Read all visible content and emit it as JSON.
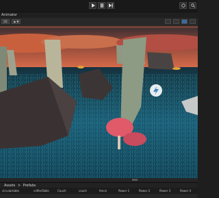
{
  "window": {
    "tab_label": "Animator"
  },
  "play_controls": {
    "play_icon": "play-icon",
    "pause_icon": "pause-icon",
    "step_icon": "step-icon"
  },
  "scene_toolbar": {
    "shading_mode": "2D",
    "render_chip": "◉ ▼",
    "gizmos_chip": "Gizmos"
  },
  "scene": {
    "gizmo_icon": "lightning-icon"
  },
  "breadcrumb": {
    "root": "Assets",
    "separator": ">",
    "current": "Prefabs"
  },
  "assets": [
    "circulartable",
    "coffeeTable",
    "Couch",
    "couch",
    "fence",
    "flower 1",
    "flower 2",
    "flower 3",
    "flower 4"
  ],
  "colors": {
    "sky_top": "#3a2e31",
    "sky_glow": "#e8754d",
    "ground": "#1e5b76",
    "mushroom_cap": "#e05a6a",
    "accent_blue": "#3d6aa0"
  }
}
